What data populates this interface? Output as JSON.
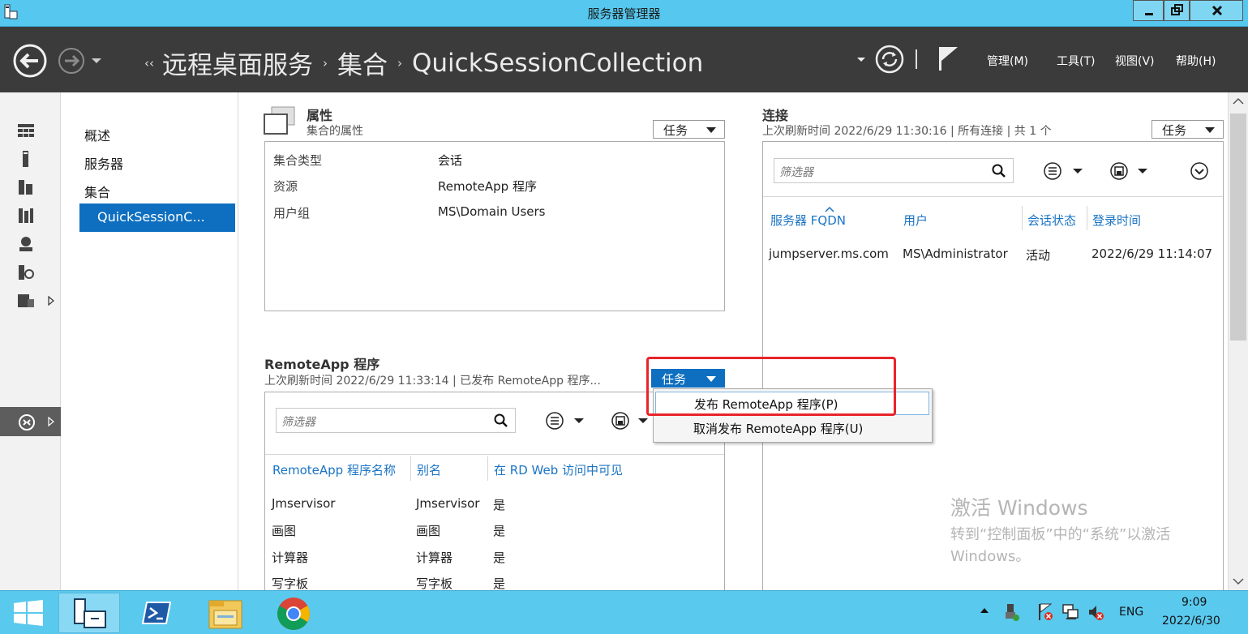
{
  "window": {
    "title": "服务器管理器",
    "controls": [
      "minimize",
      "maximize",
      "close"
    ]
  },
  "header": {
    "breadcrumb_lead": "‹‹",
    "breadcrumbs": [
      "远程桌面服务",
      "集合",
      "QuickSessionCollection"
    ],
    "separator": "›",
    "menu": {
      "manage": "管理(M)",
      "tools": "工具(T)",
      "view": "视图(V)",
      "help": "帮助(H)"
    },
    "divider": "|"
  },
  "nav": {
    "items": [
      "概述",
      "服务器",
      "集合"
    ],
    "selected": "QuickSessionC..."
  },
  "properties": {
    "title": "属性",
    "subtitle": "集合的属性",
    "tasks_label": "任务",
    "rows": [
      {
        "key": "集合类型",
        "value": "会话"
      },
      {
        "key": "资源",
        "value": "RemoteApp 程序"
      },
      {
        "key": "用户组",
        "value": "MS\\Domain Users"
      }
    ]
  },
  "connections": {
    "title": "连接",
    "subtitle": "上次刷新时间 2022/6/29 11:30:16 | 所有连接  | 共 1 个",
    "tasks_label": "任务",
    "filter_placeholder": "筛选器",
    "columns": [
      "服务器 FQDN",
      "用户",
      "会话状态",
      "登录时间"
    ],
    "rows": [
      [
        "jumpserver.ms.com",
        "MS\\Administrator",
        "活动",
        "2022/6/29 11:14:07"
      ]
    ]
  },
  "remoteapp": {
    "title": "RemoteApp 程序",
    "subtitle": "上次刷新时间 2022/6/29 11:33:14 | 已发布 RemoteApp 程序...",
    "tasks_label": "任务",
    "filter_placeholder": "筛选器",
    "columns": [
      "RemoteApp 程序名称",
      "别名",
      "在 RD Web 访问中可见"
    ],
    "rows": [
      [
        "Jmservisor",
        "Jmservisor",
        "是"
      ],
      [
        "画图",
        "画图",
        "是"
      ],
      [
        "计算器",
        "计算器",
        "是"
      ],
      [
        "写字板",
        "写字板",
        "是"
      ]
    ]
  },
  "dropdown": {
    "items": [
      "发布 RemoteApp 程序(P)",
      "取消发布 RemoteApp 程序(U)"
    ]
  },
  "watermark": {
    "line1": "激活 Windows",
    "line2": "转到“控制面板”中的“系统”以激活",
    "line3": "Windows。"
  },
  "taskbar": {
    "apps": [
      "start",
      "server-manager",
      "powershell",
      "file-explorer",
      "chrome"
    ],
    "tray": {
      "lang": "ENG",
      "time": "9:09",
      "date": "2022/6/30"
    }
  },
  "colors": {
    "titlebar": "#56c7ee",
    "header": "#3b3b3b",
    "accent": "#0e6fc0",
    "link": "#1a74c4",
    "highlight": "#e8252a"
  }
}
